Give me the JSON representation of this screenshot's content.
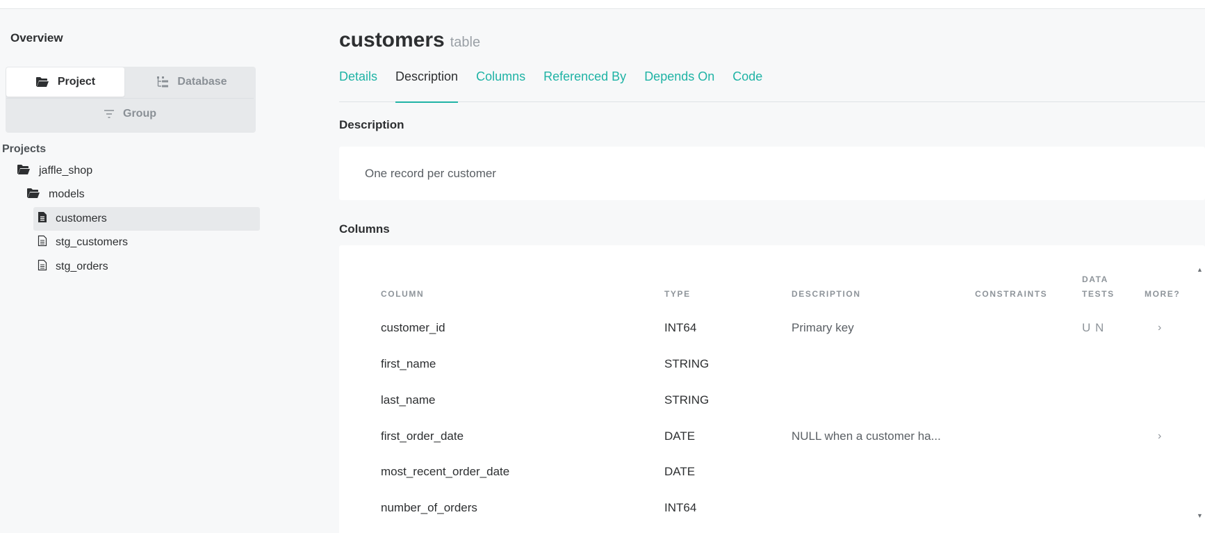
{
  "sidebar": {
    "title": "Overview",
    "switcher": {
      "project_label": "Project",
      "database_label": "Database",
      "group_label": "Group"
    },
    "projects_label": "Projects",
    "tree": {
      "project": "jaffle_shop",
      "folder": "models",
      "items": [
        "customers",
        "stg_customers",
        "stg_orders"
      ],
      "selected": "customers"
    }
  },
  "main": {
    "title": "customers",
    "type": "table",
    "tabs": [
      "Details",
      "Description",
      "Columns",
      "Referenced By",
      "Depends On",
      "Code"
    ],
    "active_tab": "Description",
    "description_heading": "Description",
    "description_text": "One record per customer",
    "columns_heading": "Columns",
    "table": {
      "headers": {
        "column": "COLUMN",
        "type": "TYPE",
        "description": "DESCRIPTION",
        "constraints": "CONSTRAINTS",
        "data_tests": "DATA TESTS",
        "more": "MORE?"
      },
      "rows": [
        {
          "name": "customer_id",
          "type": "INT64",
          "description": "Primary key",
          "constraints": "",
          "tests": "U N",
          "more": "›"
        },
        {
          "name": "first_name",
          "type": "STRING",
          "description": "",
          "constraints": "",
          "tests": "",
          "more": ""
        },
        {
          "name": "last_name",
          "type": "STRING",
          "description": "",
          "constraints": "",
          "tests": "",
          "more": ""
        },
        {
          "name": "first_order_date",
          "type": "DATE",
          "description": "NULL when a customer ha...",
          "constraints": "",
          "tests": "",
          "more": "›"
        },
        {
          "name": "most_recent_order_date",
          "type": "DATE",
          "description": "",
          "constraints": "",
          "tests": "",
          "more": ""
        },
        {
          "name": "number_of_orders",
          "type": "INT64",
          "description": "",
          "constraints": "",
          "tests": "",
          "more": ""
        }
      ]
    }
  },
  "colors": {
    "accent": "#1fb3a5",
    "text": "#2d2f31",
    "muted": "#8e949a",
    "background": "#f7f8f9"
  },
  "icons": {
    "project": "folder-open-icon",
    "database": "tree-structure-icon",
    "group": "filter-lines-icon",
    "folder": "folder-open-icon",
    "file_selected": "document-filled-icon",
    "file": "document-outline-icon"
  }
}
